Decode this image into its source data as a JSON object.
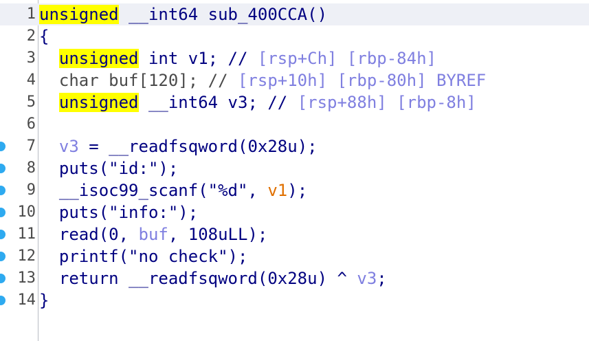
{
  "editor": {
    "lines": [
      {
        "num": "1",
        "breakpoint": false,
        "highlighted": true,
        "tokens": [
          {
            "text": "unsigned",
            "cls": "kw"
          },
          {
            "text": " __int64 sub_400CCA()",
            "cls": "normal"
          }
        ]
      },
      {
        "num": "2",
        "breakpoint": false,
        "highlighted": false,
        "tokens": [
          {
            "text": "{",
            "cls": "normal"
          }
        ]
      },
      {
        "num": "3",
        "breakpoint": false,
        "highlighted": false,
        "tokens": [
          {
            "text": "  ",
            "cls": "normal"
          },
          {
            "text": "unsigned",
            "cls": "kw"
          },
          {
            "text": " int v1; // ",
            "cls": "normal"
          },
          {
            "text": "[rsp+Ch] [rbp-84h]",
            "cls": "cmtv"
          }
        ]
      },
      {
        "num": "4",
        "breakpoint": false,
        "highlighted": false,
        "tokens": [
          {
            "text": "  char buf[120]; // ",
            "cls": "gray"
          },
          {
            "text": "[rsp+10h] [rbp-80h] BYREF",
            "cls": "cmtv"
          }
        ]
      },
      {
        "num": "5",
        "breakpoint": false,
        "highlighted": false,
        "tokens": [
          {
            "text": "  ",
            "cls": "normal"
          },
          {
            "text": "unsigned",
            "cls": "kw"
          },
          {
            "text": " __int64 v3; // ",
            "cls": "normal"
          },
          {
            "text": "[rsp+88h] [rbp-8h]",
            "cls": "cmtv"
          }
        ]
      },
      {
        "num": "6",
        "breakpoint": false,
        "highlighted": false,
        "tokens": []
      },
      {
        "num": "7",
        "breakpoint": true,
        "highlighted": false,
        "tokens": [
          {
            "text": "  ",
            "cls": "normal"
          },
          {
            "text": "v3",
            "cls": "vr"
          },
          {
            "text": " = __readfsqword(0x28u);",
            "cls": "normal"
          }
        ]
      },
      {
        "num": "8",
        "breakpoint": true,
        "highlighted": false,
        "tokens": [
          {
            "text": "  puts(\"id:\");",
            "cls": "normal"
          }
        ]
      },
      {
        "num": "9",
        "breakpoint": true,
        "highlighted": false,
        "tokens": [
          {
            "text": "  __isoc99_scanf(\"%d\", ",
            "cls": "normal"
          },
          {
            "text": "v1",
            "cls": "orange"
          },
          {
            "text": ");",
            "cls": "normal"
          }
        ]
      },
      {
        "num": "10",
        "breakpoint": true,
        "highlighted": false,
        "tokens": [
          {
            "text": "  puts(\"info:\");",
            "cls": "normal"
          }
        ]
      },
      {
        "num": "11",
        "breakpoint": true,
        "highlighted": false,
        "tokens": [
          {
            "text": "  read(0, ",
            "cls": "normal"
          },
          {
            "text": "buf",
            "cls": "vr"
          },
          {
            "text": ", 108uLL);",
            "cls": "normal"
          }
        ]
      },
      {
        "num": "12",
        "breakpoint": true,
        "highlighted": false,
        "tokens": [
          {
            "text": "  printf(\"no check\");",
            "cls": "normal"
          }
        ]
      },
      {
        "num": "13",
        "breakpoint": true,
        "highlighted": false,
        "tokens": [
          {
            "text": "  return __readfsqword(0x28u) ^ ",
            "cls": "normal"
          },
          {
            "text": "v3",
            "cls": "vr"
          },
          {
            "text": ";",
            "cls": "normal"
          }
        ]
      },
      {
        "num": "14",
        "breakpoint": true,
        "highlighted": false,
        "tokens": [
          {
            "text": "}",
            "cls": "normal"
          }
        ]
      }
    ]
  },
  "colors": {
    "keyword_highlight": "#ffff00",
    "code_text": "#000080",
    "variable_light": "#7f7fe0",
    "argument_orange": "#e07000",
    "breakpoint": "#2eaaf0",
    "current_line_bg": "#eef0f6"
  }
}
